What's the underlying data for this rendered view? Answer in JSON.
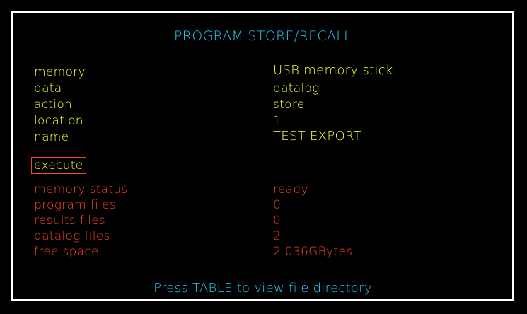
{
  "title": "PROGRAM STORE/RECALL",
  "settings": [
    {
      "label": "memory",
      "value": "USB memory stick"
    },
    {
      "label": "data",
      "value": "datalog"
    },
    {
      "label": "action",
      "value": "store"
    },
    {
      "label": "location",
      "value": "1"
    },
    {
      "label": "name",
      "value": "TEST EXPORT"
    }
  ],
  "execute_label": "execute",
  "status": [
    {
      "label": "memory status",
      "value": "ready"
    },
    {
      "label": "program files",
      "value": "0"
    },
    {
      "label": "results files",
      "value": "0"
    },
    {
      "label": "datalog files",
      "value": "2"
    },
    {
      "label": "free space",
      "value": "2.036GBytes"
    }
  ],
  "footer": "Press TABLE to view file directory",
  "colors": {
    "background": "#000000",
    "frame": "#ffffff",
    "title": "#22ccee",
    "settings": "#ffff33",
    "status": "#ff4422",
    "selection_box": "#ff4422"
  }
}
